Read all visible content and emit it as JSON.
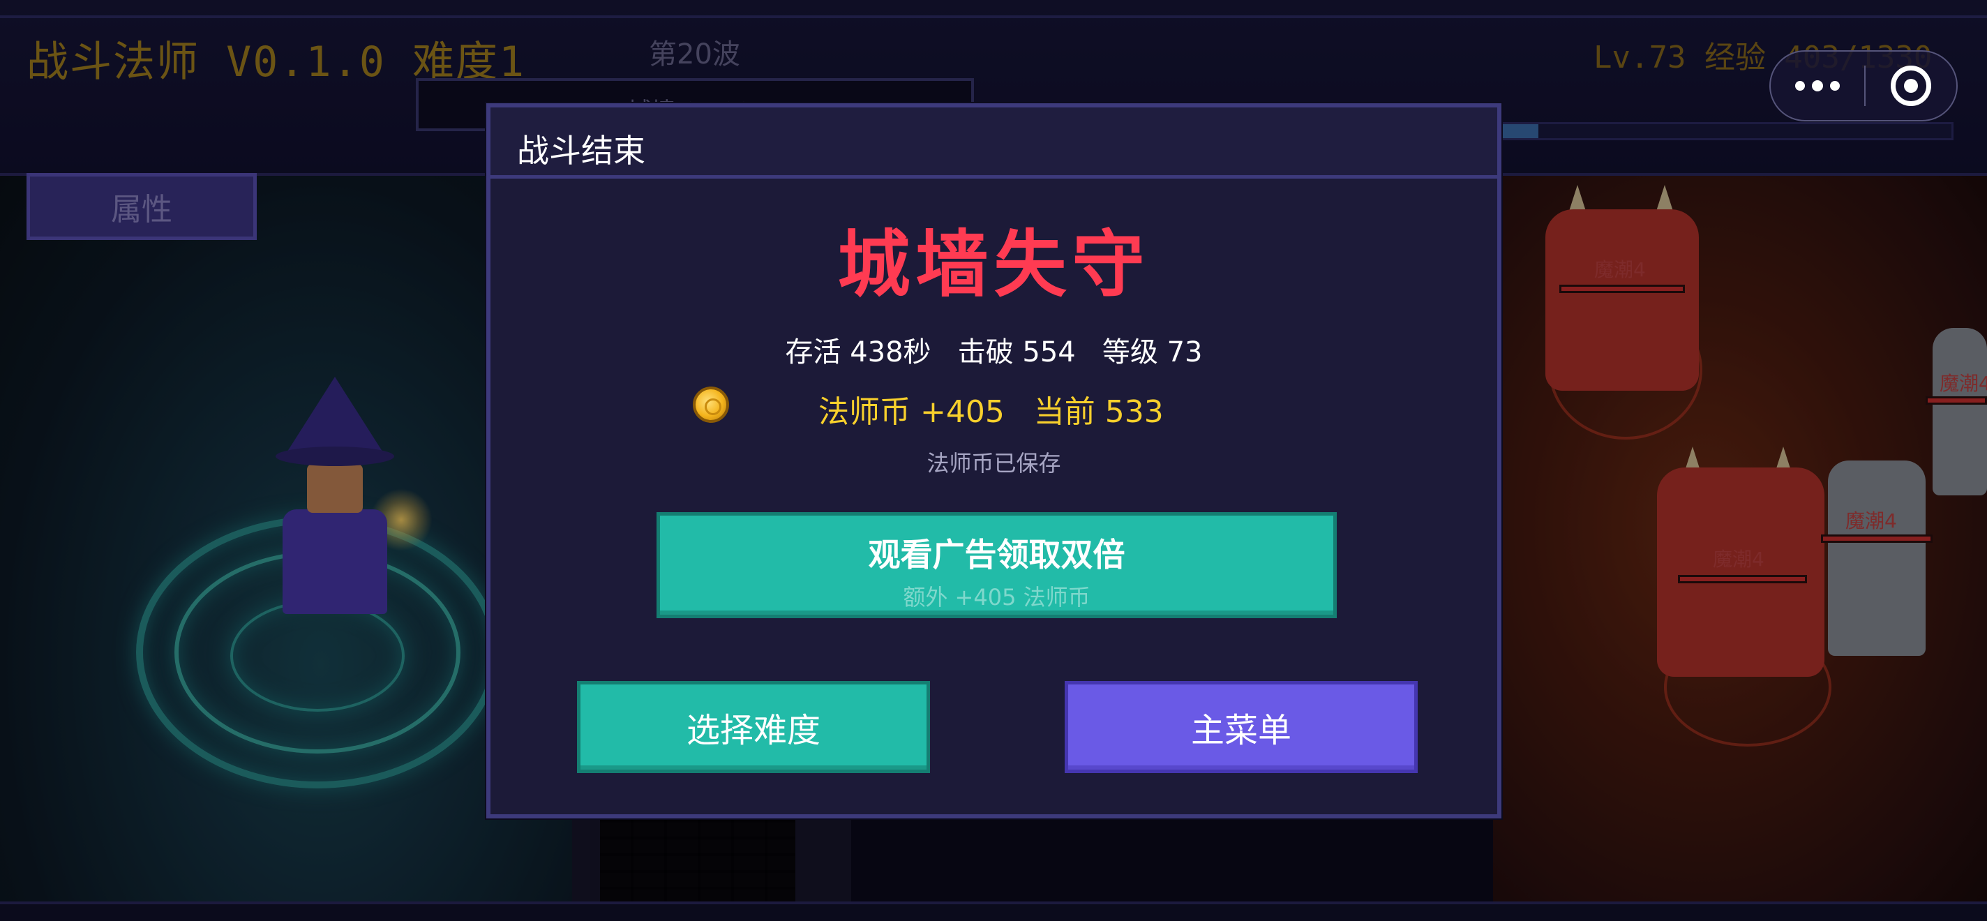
{
  "hud": {
    "title": "战斗法师 V0.1.0  难度1",
    "wave": "第20波",
    "wall": "城墙 0/100",
    "level": "Lv.73  经验 403/1330",
    "attributes_button": "属性",
    "xp_progress": 0.08
  },
  "enemies": [
    {
      "label": "魔潮4"
    },
    {
      "label": "魔潮4"
    },
    {
      "label": "魔潮4"
    },
    {
      "label": "魔潮4"
    }
  ],
  "capsule": {
    "more_icon": "more-dots-icon",
    "close_icon": "target-close-icon"
  },
  "modal": {
    "title": "战斗结束",
    "result": "城墙失守",
    "stats": "存活 438秒   击破 554   等级 73",
    "coin_icon": "coin-icon",
    "coins": "法师币 +405   当前 533",
    "saved": "法师币已保存",
    "ad_button": {
      "label": "观看广告领取双倍",
      "sublabel": "额外 +405 法师币"
    },
    "difficulty_button": "选择难度",
    "menu_button": "主菜单"
  },
  "colors": {
    "result": "#ff3b52",
    "coins": "#f8d02c",
    "teal_button": "#22bba8",
    "purple_button": "#6a5ae6",
    "panel": "#1c1a38"
  }
}
